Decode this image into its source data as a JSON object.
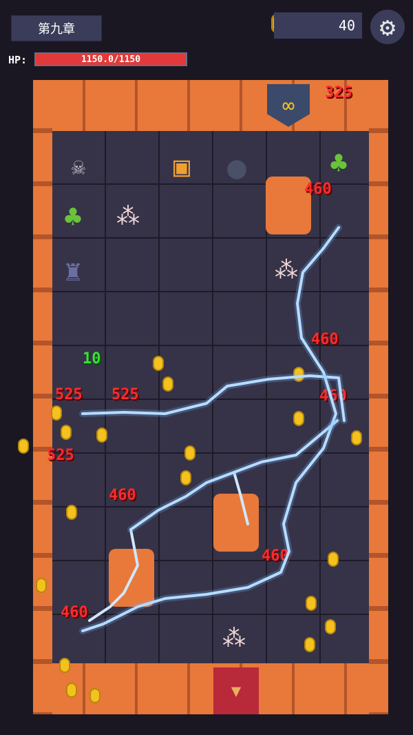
{
  "hud": {
    "chapter": "第九章",
    "coins": "40",
    "hp_label": "HP:",
    "hp_text": "1150.0/1150",
    "hp_fraction": 1.0
  },
  "board": {
    "tiles": [
      {
        "icon": "skull-bones-icon",
        "glyph": "☠"
      },
      {
        "icon": "treasure-chest-icon",
        "glyph": "▣"
      },
      {
        "icon": "bomb-icon",
        "glyph": "●"
      },
      {
        "icon": "green-demon-icon",
        "glyph": "♣"
      },
      {
        "icon": "green-demon-icon",
        "glyph": "♣"
      },
      {
        "icon": "candles-icon",
        "glyph": "⁂"
      },
      {
        "icon": "orange-barrel-icon",
        "glyph": "▮"
      },
      {
        "icon": "stone-gargoyle-icon",
        "glyph": "♜"
      },
      {
        "icon": "candles-icon",
        "glyph": "⁂"
      },
      {
        "icon": "orange-barrel-icon",
        "glyph": "▮"
      },
      {
        "icon": "orange-barrel-icon",
        "glyph": "▮"
      },
      {
        "icon": "candles-icon",
        "glyph": "⁂"
      },
      {
        "icon": "banner-icon",
        "glyph": "∞"
      },
      {
        "icon": "red-door-banner-icon",
        "glyph": "▼"
      }
    ],
    "damage_numbers": [
      "325",
      "460",
      "460",
      "460",
      "525",
      "525",
      "525",
      "460",
      "460",
      "460"
    ],
    "heal_number": "10"
  },
  "colors": {
    "accent_panel": "#3a3c5a",
    "hp_red": "#e23a3a",
    "damage_red": "#ff2b2b",
    "heal_green": "#3adf3a",
    "brick": "#e8793a",
    "lightning": "#cfe8ff"
  }
}
